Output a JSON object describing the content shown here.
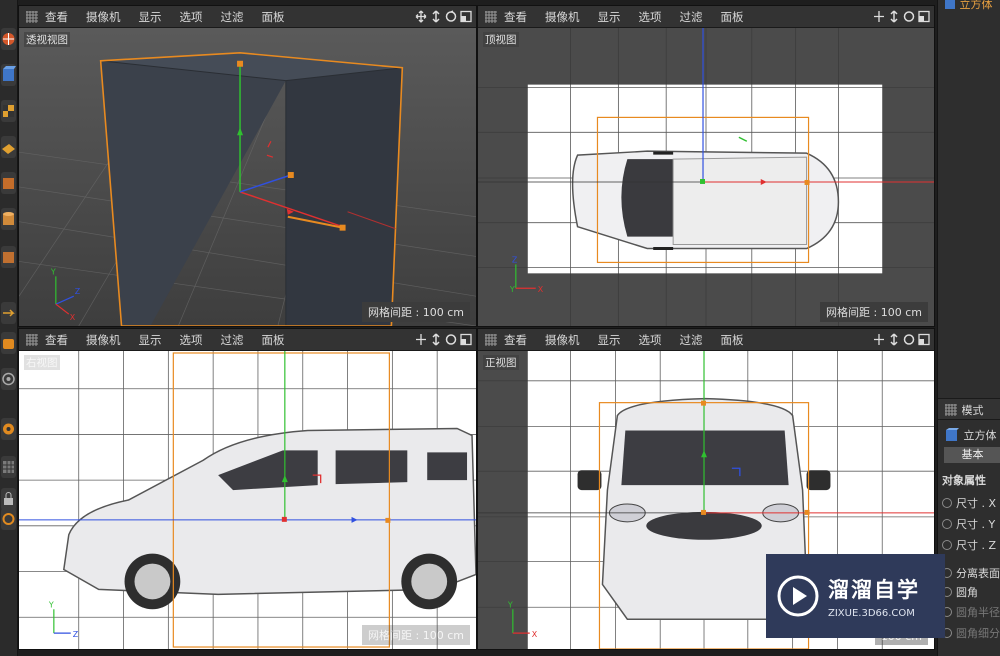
{
  "viewport_menu": [
    "查看",
    "摄像机",
    "显示",
    "选项",
    "过滤",
    "面板"
  ],
  "viewports": {
    "perspective": {
      "label": "透视视图",
      "grid": "网格间距 : 100 cm"
    },
    "top": {
      "label": "顶视图",
      "grid": "网格间距 : 100 cm"
    },
    "right": {
      "label": "右视图",
      "grid": "网格间距 : 100 cm"
    },
    "front": {
      "label": "正视图",
      "grid": "100 cm"
    }
  },
  "axis_labels": {
    "x": "X",
    "y": "Y",
    "z": "Z"
  },
  "right_panel": {
    "object_name_top": "立方体",
    "mode_tab": "模式",
    "object_name": "立方体",
    "basic_tab": "基本",
    "section": "对象属性",
    "size_x": "尺寸 . X",
    "size_y": "尺寸 . Y",
    "size_z": "尺寸 . Z",
    "separate_surfaces": "分离表面",
    "fillet": "圆角",
    "fillet_radius": "圆角半径",
    "fillet_subdiv": "圆角细分"
  },
  "watermark": {
    "title": "溜溜自学",
    "subtitle": "ZIXUE.3D66.COM"
  },
  "colors": {
    "axis_x": "#e03030",
    "axis_y": "#30c030",
    "axis_z": "#3050e0",
    "selection": "#e88a20",
    "cube": "#363b44",
    "watermark_bg": "#2f3a5a"
  }
}
